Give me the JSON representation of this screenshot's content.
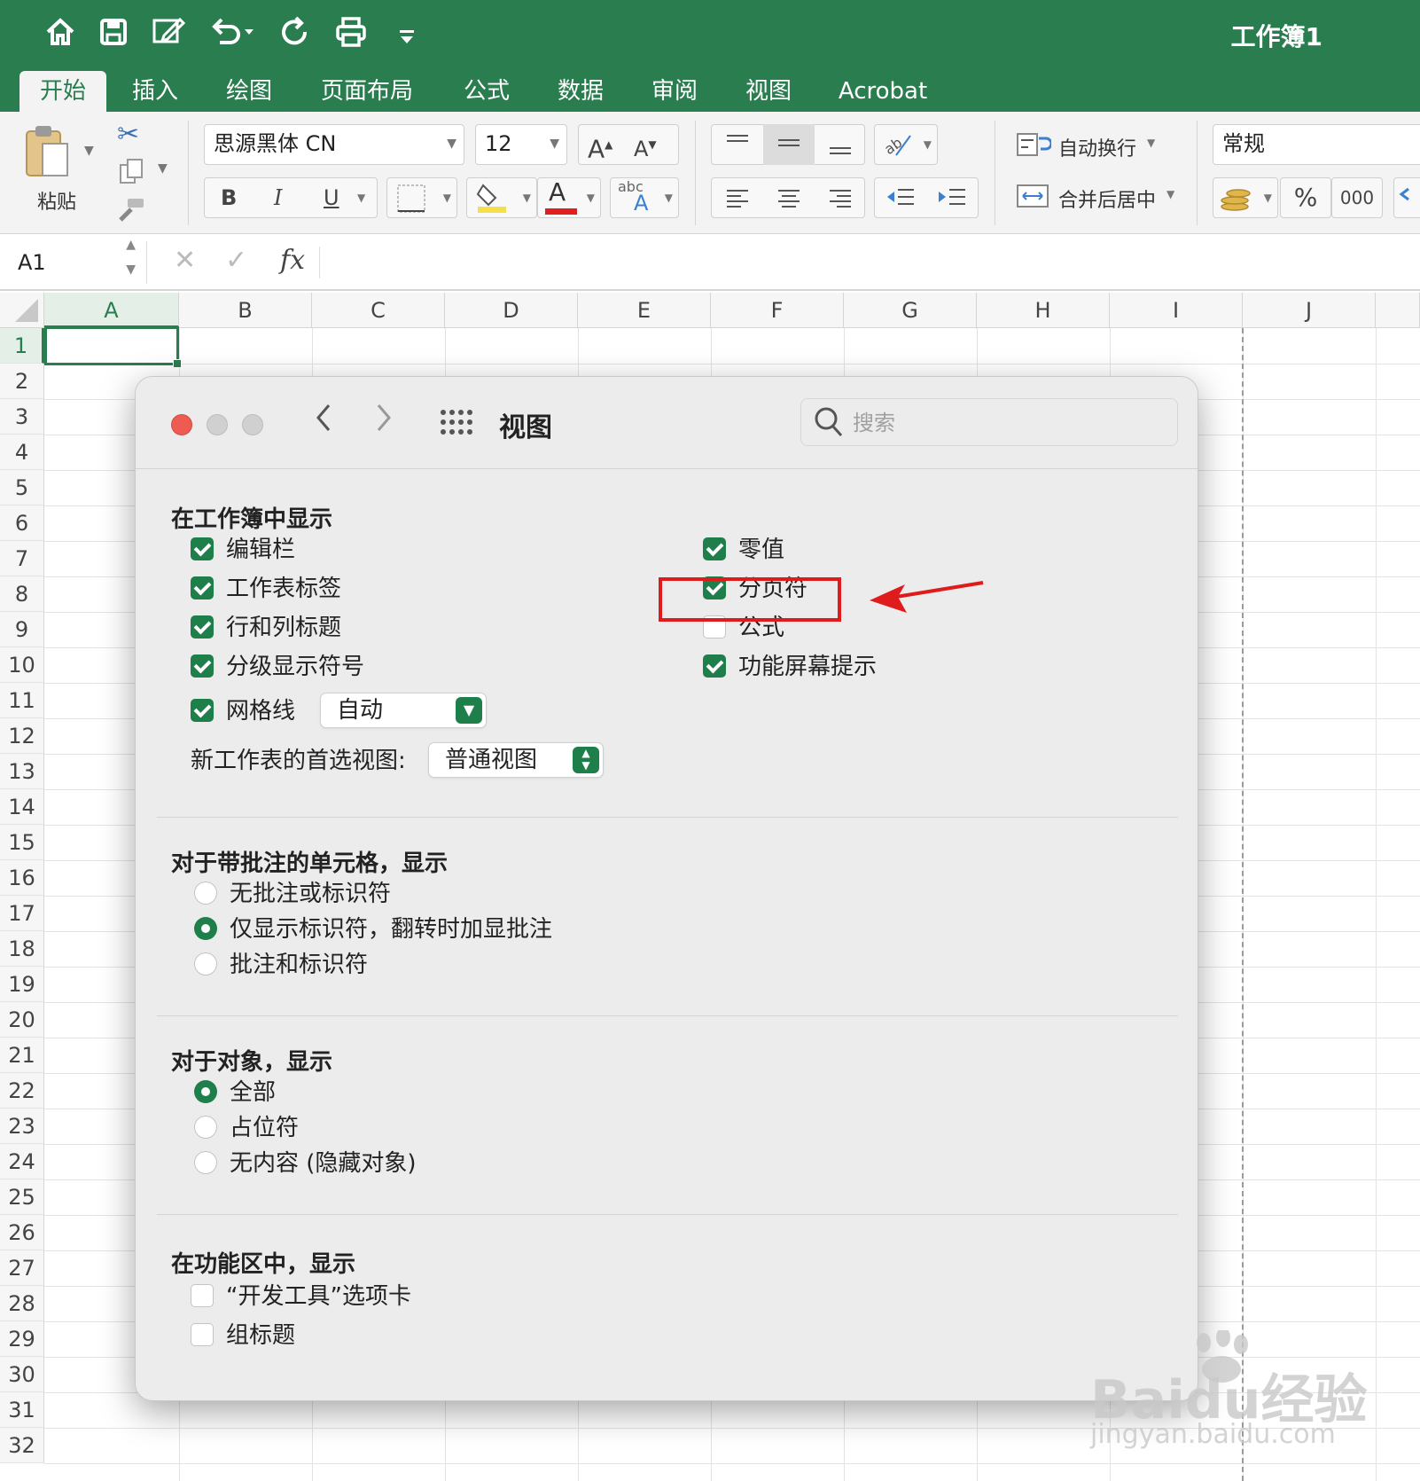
{
  "app": {
    "workbook_title": "工作簿1",
    "quick_access_icons": [
      "home-icon",
      "save-icon",
      "edit-icon",
      "undo-icon",
      "redo-icon",
      "print-icon",
      "customize-icon"
    ]
  },
  "tabs": [
    {
      "label": "开始",
      "active": true
    },
    {
      "label": "插入"
    },
    {
      "label": "绘图"
    },
    {
      "label": "页面布局"
    },
    {
      "label": "公式"
    },
    {
      "label": "数据"
    },
    {
      "label": "审阅"
    },
    {
      "label": "视图"
    },
    {
      "label": "Acrobat"
    }
  ],
  "ribbon": {
    "paste_label": "粘贴",
    "font_name": "思源黑体 CN",
    "font_size": "12",
    "grow_font": "A",
    "shrink_font": "A",
    "bold": "B",
    "italic": "I",
    "underline": "U",
    "font_color_letter": "A",
    "abc_label": "abc",
    "wrap_text_label": "自动换行",
    "merge_center_label": "合并后居中",
    "number_format": "常规",
    "percent": "%",
    "thousands": "000"
  },
  "formula_bar": {
    "cell_name": "A1",
    "fx": "fx",
    "cancel": "✕",
    "confirm": "✓"
  },
  "grid": {
    "columns": [
      "A",
      "B",
      "C",
      "D",
      "E",
      "F",
      "G",
      "H",
      "I",
      "J"
    ],
    "rows": [
      "1",
      "2",
      "3",
      "4",
      "5",
      "6",
      "7",
      "8",
      "9",
      "10",
      "11",
      "12",
      "13",
      "14",
      "15",
      "16",
      "17",
      "18",
      "19",
      "20",
      "21",
      "22",
      "23",
      "24",
      "25",
      "26",
      "27",
      "28",
      "29",
      "30",
      "31",
      "32"
    ],
    "selected_cell": "A1"
  },
  "dialog": {
    "title": "视图",
    "search_placeholder": "搜索",
    "section_show": {
      "title": "在工作簿中显示",
      "left": [
        {
          "label": "编辑栏",
          "checked": true
        },
        {
          "label": "工作表标签",
          "checked": true
        },
        {
          "label": "行和列标题",
          "checked": true
        },
        {
          "label": "分级显示符号",
          "checked": true
        },
        {
          "label": "网格线",
          "checked": true
        }
      ],
      "right": [
        {
          "label": "零值",
          "checked": true
        },
        {
          "label": "分页符",
          "checked": true
        },
        {
          "label": "公式",
          "checked": false
        },
        {
          "label": "功能屏幕提示",
          "checked": true
        }
      ],
      "gridline_color": "自动",
      "preferred_view_label": "新工作表的首选视图:",
      "preferred_view_value": "普通视图"
    },
    "section_comments": {
      "title": "对于带批注的单元格，显示",
      "options": [
        {
          "label": "无批注或标识符",
          "selected": false
        },
        {
          "label": "仅显示标识符，翻转时加显批注",
          "selected": true
        },
        {
          "label": "批注和标识符",
          "selected": false
        }
      ]
    },
    "section_objects": {
      "title": "对于对象，显示",
      "options": [
        {
          "label": "全部",
          "selected": true
        },
        {
          "label": "占位符",
          "selected": false
        },
        {
          "label": "无内容 (隐藏对象)",
          "selected": false
        }
      ]
    },
    "section_ribbon": {
      "title": "在功能区中，显示",
      "options": [
        {
          "label": "“开发工具”选项卡",
          "checked": false
        },
        {
          "label": "组标题",
          "checked": false
        }
      ]
    }
  },
  "watermark": {
    "main": "Baidu经验",
    "sub": "jingyan.baidu.com"
  },
  "colors": {
    "excel_green": "#2a7d4f",
    "check_green": "#1e7f4a",
    "highlight_red": "#e01b1b"
  }
}
